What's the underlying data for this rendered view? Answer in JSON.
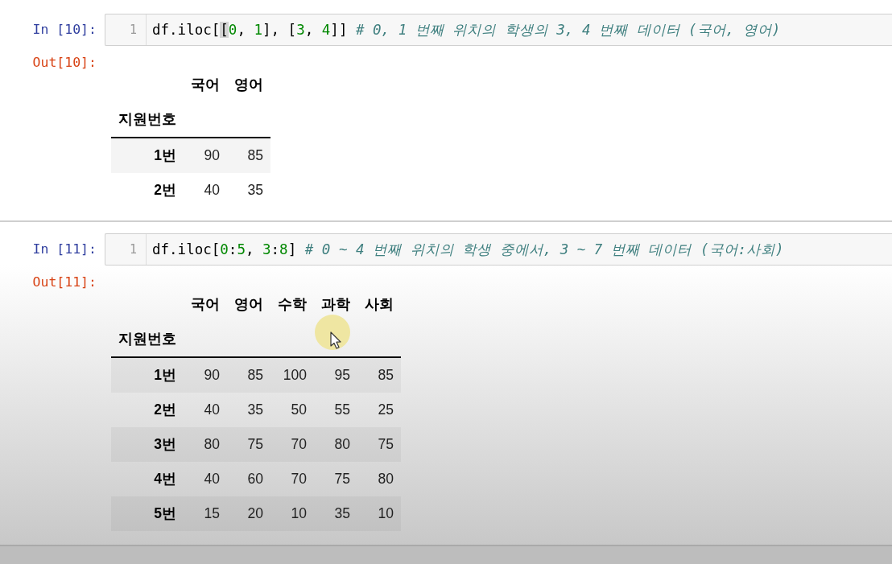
{
  "cells": [
    {
      "input": {
        "prompt": "In [10]:",
        "line_number": "1",
        "code": [
          {
            "text": "df.iloc[",
            "kind": "plain"
          },
          {
            "text": "[",
            "kind": "matched"
          },
          {
            "text": "0",
            "kind": "number"
          },
          {
            "text": ", ",
            "kind": "plain"
          },
          {
            "text": "1",
            "kind": "number"
          },
          {
            "text": "], [",
            "kind": "plain"
          },
          {
            "text": "3",
            "kind": "number"
          },
          {
            "text": ", ",
            "kind": "plain"
          },
          {
            "text": "4",
            "kind": "number"
          },
          {
            "text": "]] ",
            "kind": "plain"
          },
          {
            "text": "# 0, 1 번째 위치의 학생의 3, 4 번째 데이터 (국어, 영어)",
            "kind": "comment"
          }
        ]
      },
      "output": {
        "prompt": "Out[10]:",
        "table": {
          "columns": [
            "국어",
            "영어"
          ],
          "index_name": "지원번호",
          "rows": [
            {
              "label": "1번",
              "values": [
                "90",
                "85"
              ]
            },
            {
              "label": "2번",
              "values": [
                "40",
                "35"
              ]
            }
          ]
        }
      }
    },
    {
      "input": {
        "prompt": "In [11]:",
        "line_number": "1",
        "code": [
          {
            "text": "df.iloc[",
            "kind": "plain"
          },
          {
            "text": "0",
            "kind": "number"
          },
          {
            "text": ":",
            "kind": "plain"
          },
          {
            "text": "5",
            "kind": "number"
          },
          {
            "text": ", ",
            "kind": "plain"
          },
          {
            "text": "3",
            "kind": "number"
          },
          {
            "text": ":",
            "kind": "plain"
          },
          {
            "text": "8",
            "kind": "number"
          },
          {
            "text": "] ",
            "kind": "plain"
          },
          {
            "text": "# 0 ~ 4 번째 위치의 학생 중에서, 3 ~ 7 번째 데이터 (국어:사회)",
            "kind": "comment"
          }
        ]
      },
      "output": {
        "prompt": "Out[11]:",
        "mouse_pointer": true,
        "table": {
          "columns": [
            "국어",
            "영어",
            "수학",
            "과학",
            "사회"
          ],
          "index_name": "지원번호",
          "rows": [
            {
              "label": "1번",
              "values": [
                "90",
                "85",
                "100",
                "95",
                "85"
              ]
            },
            {
              "label": "2번",
              "values": [
                "40",
                "35",
                "50",
                "55",
                "25"
              ]
            },
            {
              "label": "3번",
              "values": [
                "80",
                "75",
                "70",
                "80",
                "75"
              ]
            },
            {
              "label": "4번",
              "values": [
                "40",
                "60",
                "70",
                "75",
                "80"
              ]
            },
            {
              "label": "5번",
              "values": [
                "15",
                "20",
                "10",
                "35",
                "10"
              ]
            }
          ]
        }
      }
    }
  ]
}
